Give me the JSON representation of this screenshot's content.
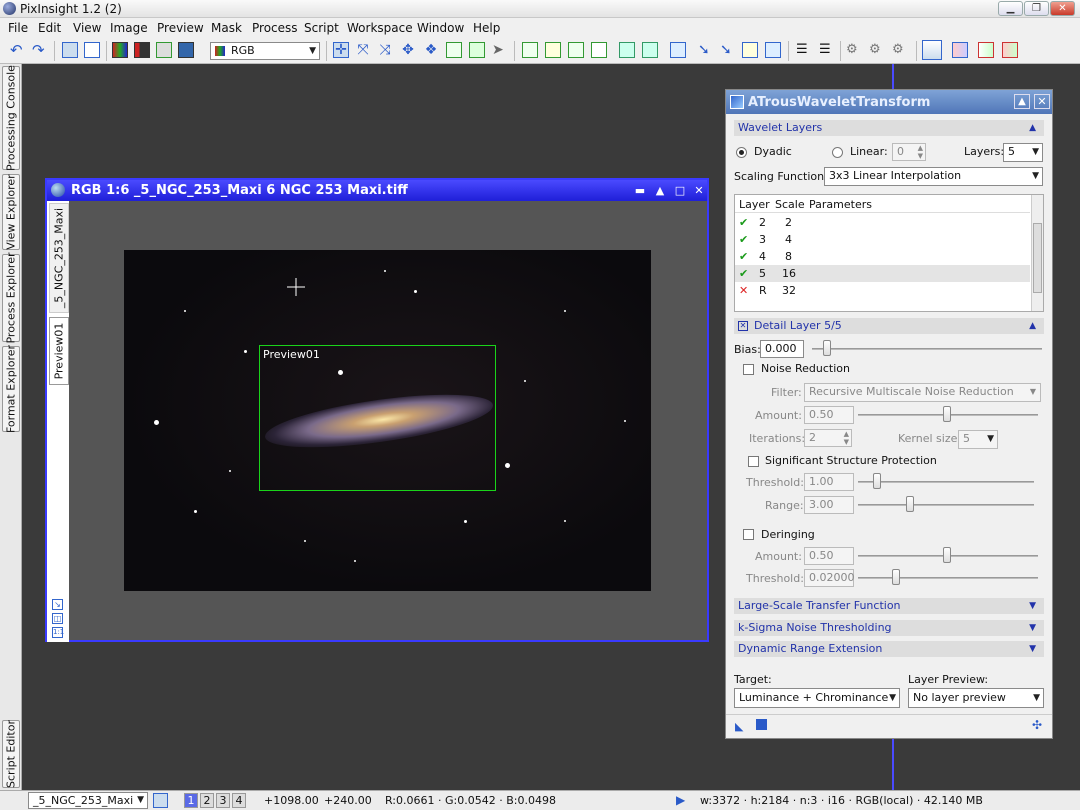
{
  "app": {
    "title": "PixInsight 1.2 (2)"
  },
  "menu": [
    "File",
    "Edit",
    "View",
    "Image",
    "Preview",
    "Mask",
    "Process",
    "Script",
    "Workspace",
    "Window",
    "Help"
  ],
  "toolbar": {
    "color_space": "RGB"
  },
  "side_tabs": [
    "Processing Console",
    "View Explorer",
    "Process Explorer",
    "Format Explorer",
    "Script Editor"
  ],
  "image_window": {
    "title": "RGB 1:6 _5_NGC_253_Maxi 6 NGC 253 Maxi.tiff",
    "view_tab": "_5_NGC_253_Maxi",
    "preview_tab": "Preview01",
    "preview_label": "Preview01"
  },
  "panel": {
    "title": "ATrousWaveletTransform",
    "wavelet_layers_header": "Wavelet Layers",
    "dyadic_label": "Dyadic",
    "linear_label": "Linear:",
    "linear_value": "0",
    "layers_label": "Layers:",
    "layers_value": "5",
    "scaling_label": "Scaling Function:",
    "scaling_value": "3x3 Linear Interpolation",
    "tree_headers": [
      "Layer",
      "Scale",
      "Parameters"
    ],
    "rows": [
      {
        "layer": "2",
        "scale": "2",
        "enabled": true
      },
      {
        "layer": "3",
        "scale": "4",
        "enabled": true
      },
      {
        "layer": "4",
        "scale": "8",
        "enabled": true
      },
      {
        "layer": "5",
        "scale": "16",
        "enabled": true
      },
      {
        "layer": "R",
        "scale": "32",
        "enabled": false
      }
    ],
    "detail_header": "Detail Layer 5/5",
    "bias_label": "Bias:",
    "bias_value": "0.000",
    "noise_reduction_label": "Noise Reduction",
    "filter_label": "Filter:",
    "filter_value": "Recursive Multiscale Noise Reduction",
    "amount_label": "Amount:",
    "amount_value": "0.50",
    "iterations_label": "Iterations:",
    "iterations_value": "2",
    "kernel_label": "Kernel size:",
    "kernel_value": "5",
    "ssp_label": "Significant Structure Protection",
    "threshold_label": "Threshold:",
    "threshold_value": "1.00",
    "range_label": "Range:",
    "range_value": "3.00",
    "deringing_label": "Deringing",
    "der_amount_label": "Amount:",
    "der_amount_value": "0.50",
    "der_threshold_label": "Threshold:",
    "der_threshold_value": "0.02000",
    "large_scale_header": "Large-Scale Transfer Function",
    "ksigma_header": "k-Sigma Noise Thresholding",
    "dre_header": "Dynamic Range Extension",
    "target_label": "Target:",
    "target_value": "Luminance + Chrominance",
    "layer_preview_label": "Layer Preview:",
    "layer_preview_value": "No layer preview"
  },
  "status": {
    "view_select": "_5_NGC_253_Maxi",
    "pages": [
      "1",
      "2",
      "3",
      "4"
    ],
    "x": "+1098.00",
    "y": "+240.00",
    "rgb": "R:0.0661 · G:0.0542 · B:0.0498",
    "info": "w:3372 · h:2184 · n:3 · i16 · RGB(local) · 42.140 MB"
  }
}
